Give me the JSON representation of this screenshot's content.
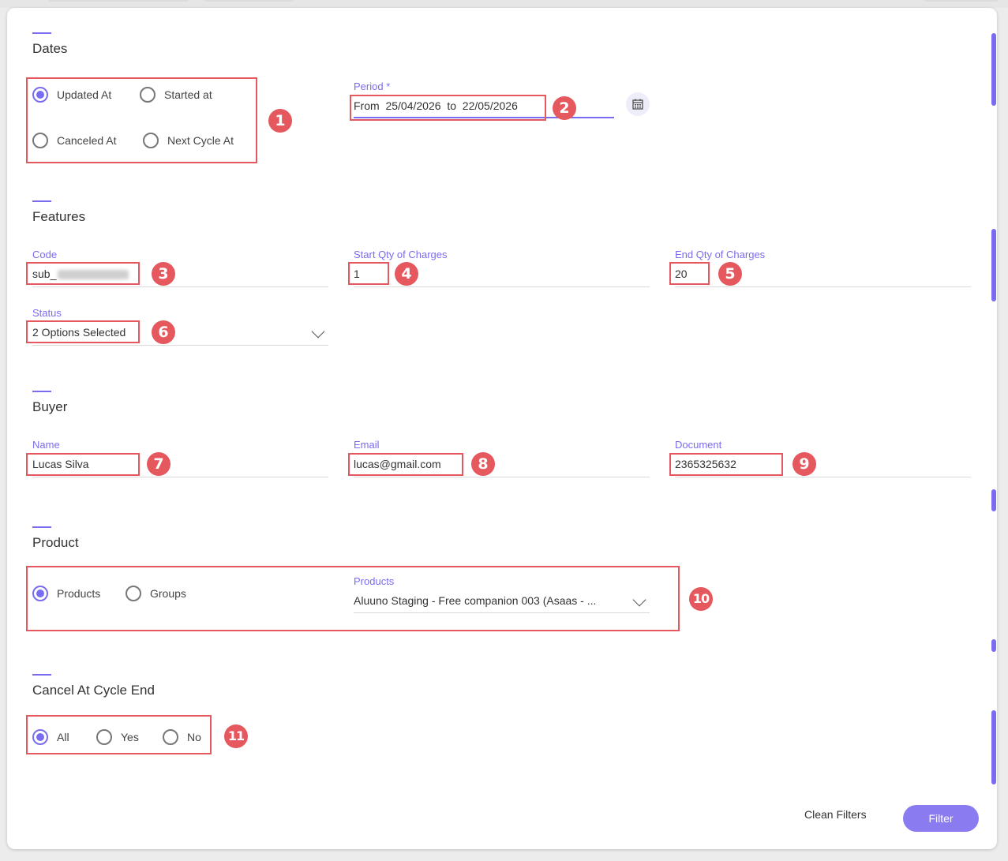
{
  "sections": {
    "dates": {
      "title": "Dates",
      "radios": [
        "Updated At",
        "Started at",
        "Canceled At",
        "Next Cycle At"
      ],
      "selected": "Updated At",
      "period": {
        "label": "Period *",
        "from_label": "From",
        "from": "25/04/2026",
        "to_label": "to",
        "to": "22/05/2026"
      }
    },
    "features": {
      "title": "Features",
      "code": {
        "label": "Code",
        "value": "sub_"
      },
      "start_qty": {
        "label": "Start Qty of Charges",
        "value": "1"
      },
      "end_qty": {
        "label": "End Qty of Charges",
        "value": "20"
      },
      "status": {
        "label": "Status",
        "value": "2 Options Selected"
      }
    },
    "buyer": {
      "title": "Buyer",
      "name": {
        "label": "Name",
        "value": "Lucas Silva"
      },
      "email": {
        "label": "Email",
        "value": "lucas@gmail.com"
      },
      "document": {
        "label": "Document",
        "value": "2365325632"
      }
    },
    "product": {
      "title": "Product",
      "radios": [
        "Products",
        "Groups"
      ],
      "selected": "Products",
      "products": {
        "label": "Products",
        "value": "Aluuno Staging - Free companion 003 (Asaas - ..."
      }
    },
    "cancel": {
      "title": "Cancel At Cycle End",
      "radios": [
        "All",
        "Yes",
        "No"
      ],
      "selected": "All"
    }
  },
  "annotations": [
    "1",
    "2",
    "3",
    "4",
    "5",
    "6",
    "7",
    "8",
    "9",
    "10",
    "11"
  ],
  "footer": {
    "clean_label": "Clean Filters",
    "filter_label": "Filter"
  },
  "colors": {
    "accent": "#7a6cf0",
    "highlight": "#e5585e",
    "button": "#8b7bf0"
  }
}
